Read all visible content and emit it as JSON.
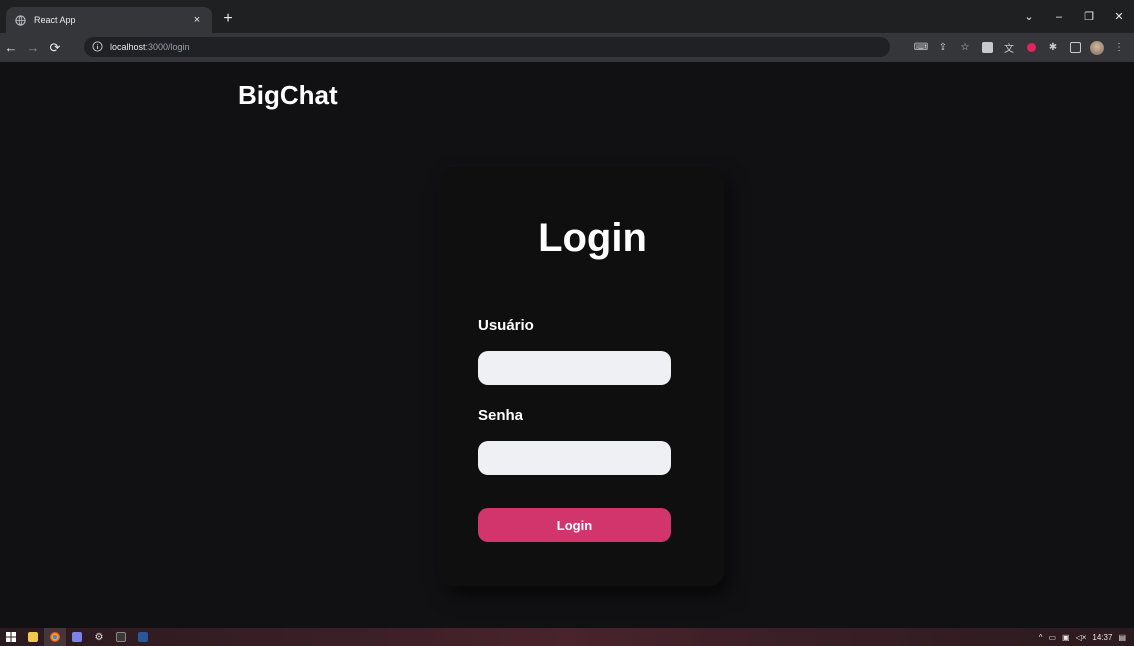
{
  "browser": {
    "tab_title": "React App",
    "tab_close": "×",
    "new_tab": "+",
    "url_host": "localhost",
    "url_path": ":3000/login",
    "window_controls": {
      "minimize": "–",
      "restore": "❐",
      "close": "✕",
      "tab_search": "⌄"
    }
  },
  "page": {
    "brand": "BigChat",
    "login_title": "Login",
    "username_label": "Usuário",
    "username_value": "",
    "password_label": "Senha",
    "password_value": "",
    "submit_label": "Login"
  },
  "taskbar": {
    "time": "14:37"
  },
  "colors": {
    "background": "#111113",
    "card": "#0f0f10",
    "input": "#eff0f4",
    "accent": "#d2356b"
  }
}
